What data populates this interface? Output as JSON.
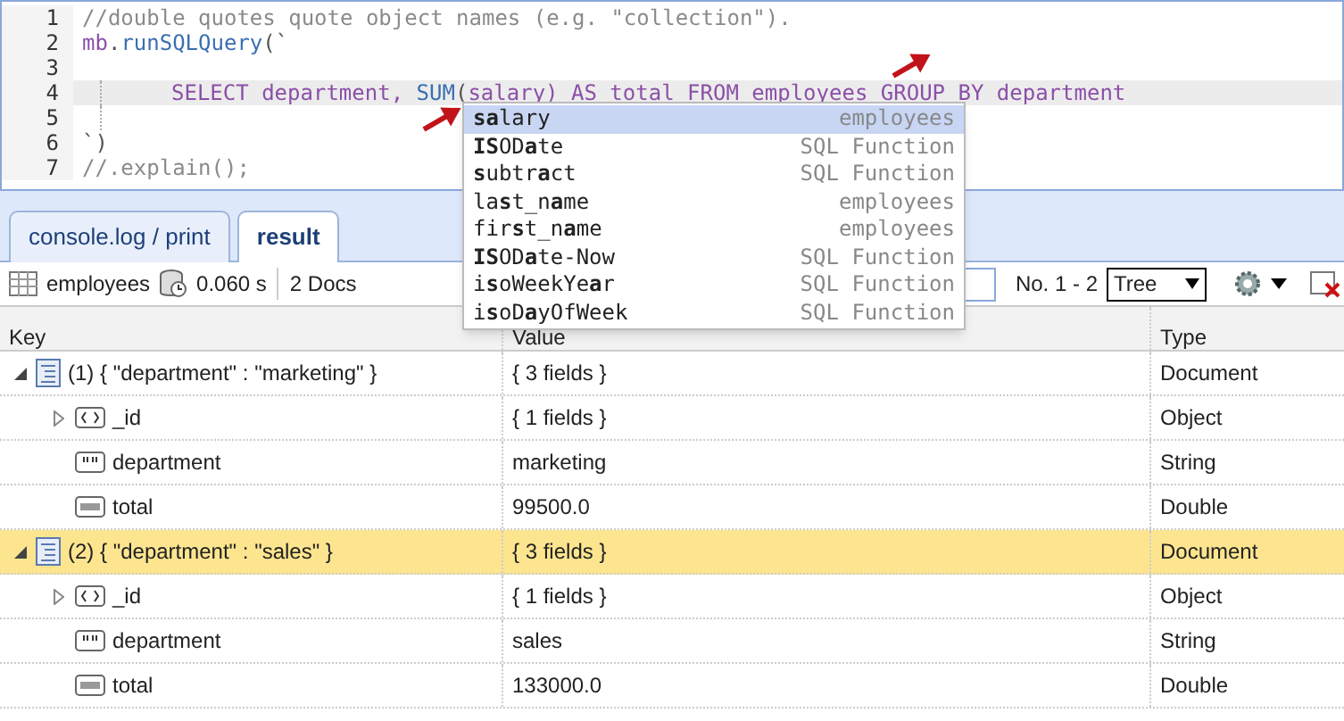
{
  "editor": {
    "lines": [
      {
        "number": "1",
        "highlighted": false,
        "indent": false,
        "tokens": [
          {
            "kind": "comment",
            "text": "//double quotes quote object names (e.g. \"collection\")."
          }
        ]
      },
      {
        "number": "2",
        "highlighted": false,
        "indent": false,
        "tokens": [
          {
            "kind": "keyword",
            "text": "mb"
          },
          {
            "kind": "plain",
            "text": "."
          },
          {
            "kind": "function",
            "text": "runSQLQuery"
          },
          {
            "kind": "plain",
            "text": "(`"
          }
        ]
      },
      {
        "number": "3",
        "highlighted": false,
        "indent": false
      },
      {
        "number": "4",
        "highlighted": true,
        "indent": true,
        "tokens": [
          {
            "kind": "keyword",
            "text": "SELECT department, "
          },
          {
            "kind": "function",
            "text": "SUM"
          },
          {
            "kind": "plain",
            "text": "("
          },
          {
            "kind": "keyword",
            "text": "salary) AS total FROM employees GROUP BY department"
          }
        ]
      },
      {
        "number": "5",
        "highlighted": false,
        "indent": true
      },
      {
        "number": "6",
        "highlighted": false,
        "indent": false,
        "tokens": [
          {
            "kind": "plain",
            "text": "`)"
          }
        ]
      },
      {
        "number": "7",
        "highlighted": false,
        "indent": false,
        "tokens": [
          {
            "kind": "comment",
            "text": "//.explain();"
          }
        ]
      }
    ]
  },
  "autocomplete": [
    {
      "label": "**sa**lary",
      "source": "employees",
      "selected": true
    },
    {
      "label": "**IS**OD**a**te",
      "source": "SQL Function",
      "selected": false
    },
    {
      "label": "**s**ubtr**a**ct",
      "source": "SQL Function",
      "selected": false
    },
    {
      "label": "la**s**t_n**a**me",
      "source": "employees",
      "selected": false
    },
    {
      "label": "fir**s**t_n**a**me",
      "source": "employees",
      "selected": false
    },
    {
      "label": "**IS**OD**a**te-Now",
      "source": "SQL Function",
      "selected": false
    },
    {
      "label": "i**s**oWeekYe**a**r",
      "source": "SQL Function",
      "selected": false
    },
    {
      "label": "i**s**oD**a**yOfWeek",
      "source": "SQL Function",
      "selected": false
    }
  ],
  "tabs": [
    {
      "label": "console.log / print",
      "selected": false
    },
    {
      "label": "result",
      "selected": true
    }
  ],
  "toolbar": {
    "collection": "employees",
    "time": "0.060 s",
    "count": "2 Docs",
    "paging": "No. 1 - 2",
    "view": "Tree"
  },
  "table": {
    "columns": [
      "Key",
      "Value",
      "Type"
    ],
    "rows": [
      {
        "kind": "document",
        "key": "(1) { \"department\" : \"marketing\" }",
        "value": "{ 3 fields }",
        "type": "Document",
        "expanded": true,
        "selected": false,
        "children": [
          {
            "kind": "object",
            "key": "_id",
            "value": "{ 1 fields }",
            "type": "Object",
            "expanded": false,
            "selected": false
          },
          {
            "kind": "string",
            "key": "department",
            "value": "marketing",
            "type": "String",
            "selected": false
          },
          {
            "kind": "number",
            "key": "total",
            "value": "99500.0",
            "type": "Double",
            "selected": false
          }
        ]
      },
      {
        "kind": "document",
        "key": "(2) { \"department\" : \"sales\" }",
        "value": "{ 3 fields }",
        "type": "Document",
        "expanded": true,
        "selected": true,
        "children": [
          {
            "kind": "object",
            "key": "_id",
            "value": "{ 1 fields }",
            "type": "Object",
            "expanded": false,
            "selected": false
          },
          {
            "kind": "string",
            "key": "department",
            "value": "sales",
            "type": "String",
            "selected": false
          },
          {
            "kind": "number",
            "key": "total",
            "value": "133000.0",
            "type": "Double",
            "selected": false
          }
        ]
      }
    ]
  }
}
